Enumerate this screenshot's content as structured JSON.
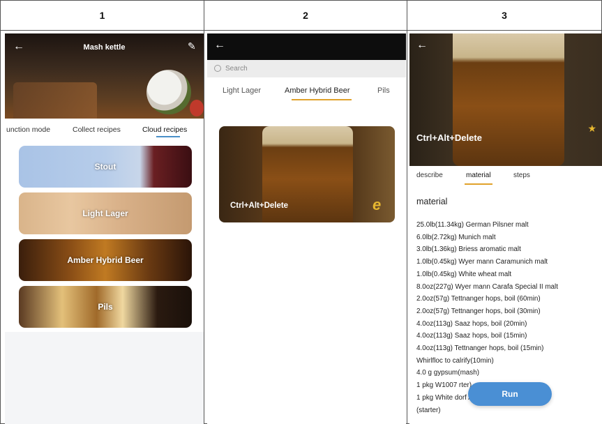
{
  "header": {
    "col1": "1",
    "col2": "2",
    "col3": "3"
  },
  "panel1": {
    "title": "Mash kettle",
    "tabs": [
      "unction mode",
      "Collect recipes",
      "Cloud recipes"
    ],
    "active_tab": "Cloud recipes",
    "recipes": [
      "Stout",
      "Light Lager",
      "Amber Hybrid Beer",
      "Pils"
    ]
  },
  "panel2": {
    "search_placeholder": "Search",
    "tabs": [
      "Light Lager",
      "Amber Hybrid Beer",
      "Pils"
    ],
    "active_tab": "Amber Hybrid Beer",
    "card_title": "Ctrl+Alt+Delete",
    "card_badge": "e"
  },
  "panel3": {
    "title": "Ctrl+Alt+Delete",
    "tabs": [
      "describe",
      "material",
      "steps"
    ],
    "active_tab": "material",
    "heading": "material",
    "materials": [
      "25.0lb(11.34kg) German Pilsner malt",
      "6.0lb(2.72kg) Munich malt",
      "3.0lb(1.36kg) Briess aromatic malt",
      "1.0lb(0.45kg) Wyer mann Caramunich malt",
      "1.0lb(0.45kg) White wheat malt",
      "8.0oz(227g) Wyer mann Carafa Special II malt",
      "2.0oz(57g) Tettnanger hops,   boil (60min)",
      "2.0oz(57g) Tettnanger hops,   boil (30min)",
      "4.0oz(113g) Saaz hops,   boil (20min)",
      "4.0oz(113g) Saaz hops,    boil (15min)",
      "4.0oz(113g) Tettnanger hops,   boil (15min)",
      "Whirlfloc to calrify(10min)",
      "4.0 g gypsum(mash)",
      "1 pkg W1007                              rter)",
      "1 pkg White                              dorf Alt yeast",
      "(starter)"
    ],
    "run_label": "Run"
  },
  "colors": {
    "accent_blue": "#4a8fd4",
    "accent_gold": "#e0a12a"
  }
}
